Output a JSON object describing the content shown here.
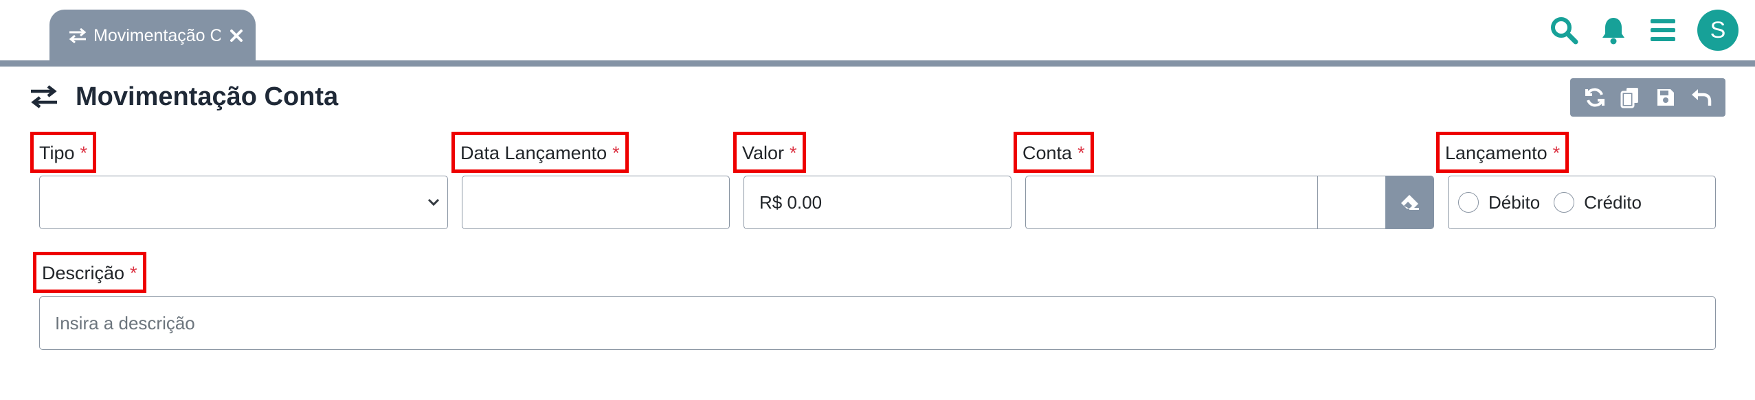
{
  "tabs": [
    {
      "label": "Movimentação Conta",
      "active": true
    }
  ],
  "topbar": {
    "icons": [
      "search-icon",
      "bell-icon",
      "menu-icon"
    ],
    "avatar_initial": "S",
    "accent_color": "#17a198"
  },
  "page": {
    "title": "Movimentação Conta",
    "actions": [
      "refresh-icon",
      "copy-icon",
      "save-icon",
      "undo-icon"
    ]
  },
  "form": {
    "required_marker": "*",
    "tipo": {
      "label": "Tipo",
      "value": ""
    },
    "data_lancamento": {
      "label": "Data Lançamento",
      "value": ""
    },
    "valor": {
      "label": "Valor",
      "value": "R$ 0.00"
    },
    "conta": {
      "label": "Conta",
      "value": "",
      "code": ""
    },
    "lancamento": {
      "label": "Lançamento",
      "options": [
        "Débito",
        "Crédito"
      ],
      "selected": null
    },
    "descricao": {
      "label": "Descrição",
      "placeholder": "Insira a descrição",
      "value": ""
    }
  },
  "colors": {
    "primary_gray": "#8493a5",
    "highlight_red": "#ee0000",
    "required_red": "#dc3545"
  }
}
